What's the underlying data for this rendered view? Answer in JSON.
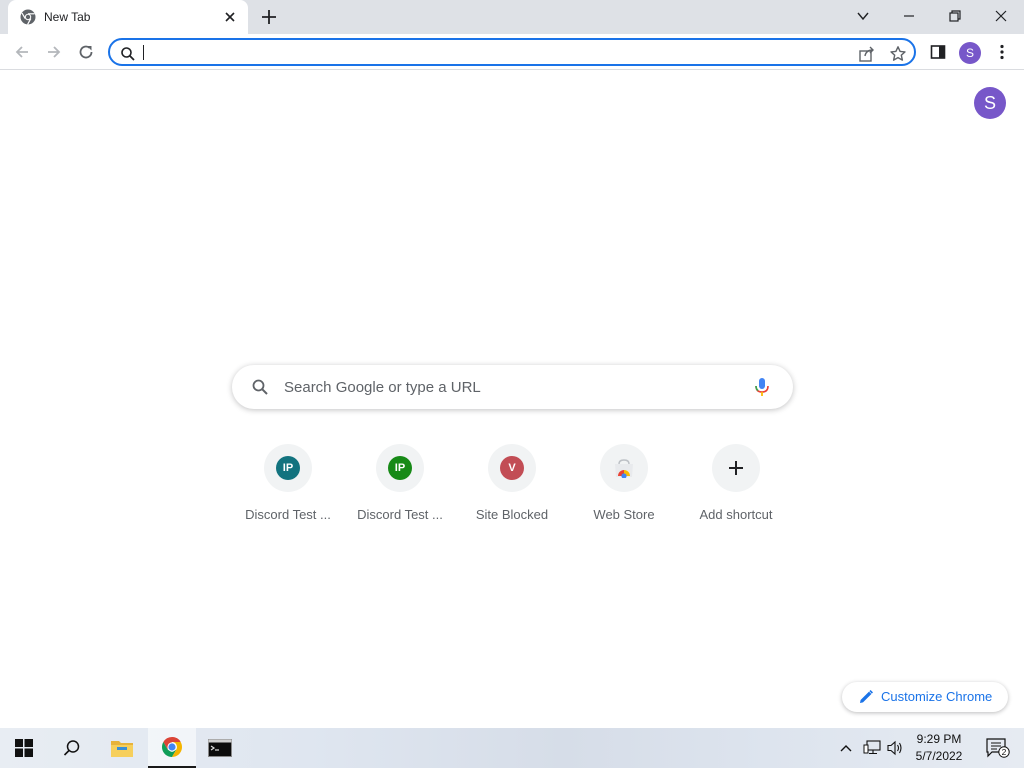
{
  "tab": {
    "title": "New Tab"
  },
  "omnibox": {
    "value": "",
    "placeholder": ""
  },
  "profile": {
    "initial": "S",
    "color": "#7757c9"
  },
  "ntp": {
    "search_placeholder": "Search Google or type a URL",
    "shortcuts": [
      {
        "label": "Discord Test ...",
        "badge": "IP",
        "badge_color": "#12737f"
      },
      {
        "label": "Discord Test ...",
        "badge": "IP",
        "badge_color": "#178a17"
      },
      {
        "label": "Site Blocked",
        "badge": "V",
        "badge_color": "#c24d55"
      },
      {
        "label": "Web Store",
        "badge": "",
        "icon": "chrome-web-store-icon"
      },
      {
        "label": "Add shortcut",
        "badge": "+",
        "icon": "plus-icon"
      }
    ],
    "customize_label": "Customize Chrome"
  },
  "taskbar": {
    "time": "9:29 PM",
    "date": "5/7/2022",
    "notification_count": "2"
  },
  "colors": {
    "accent": "#1a73e8",
    "tabstrip": "#dee1e6"
  }
}
